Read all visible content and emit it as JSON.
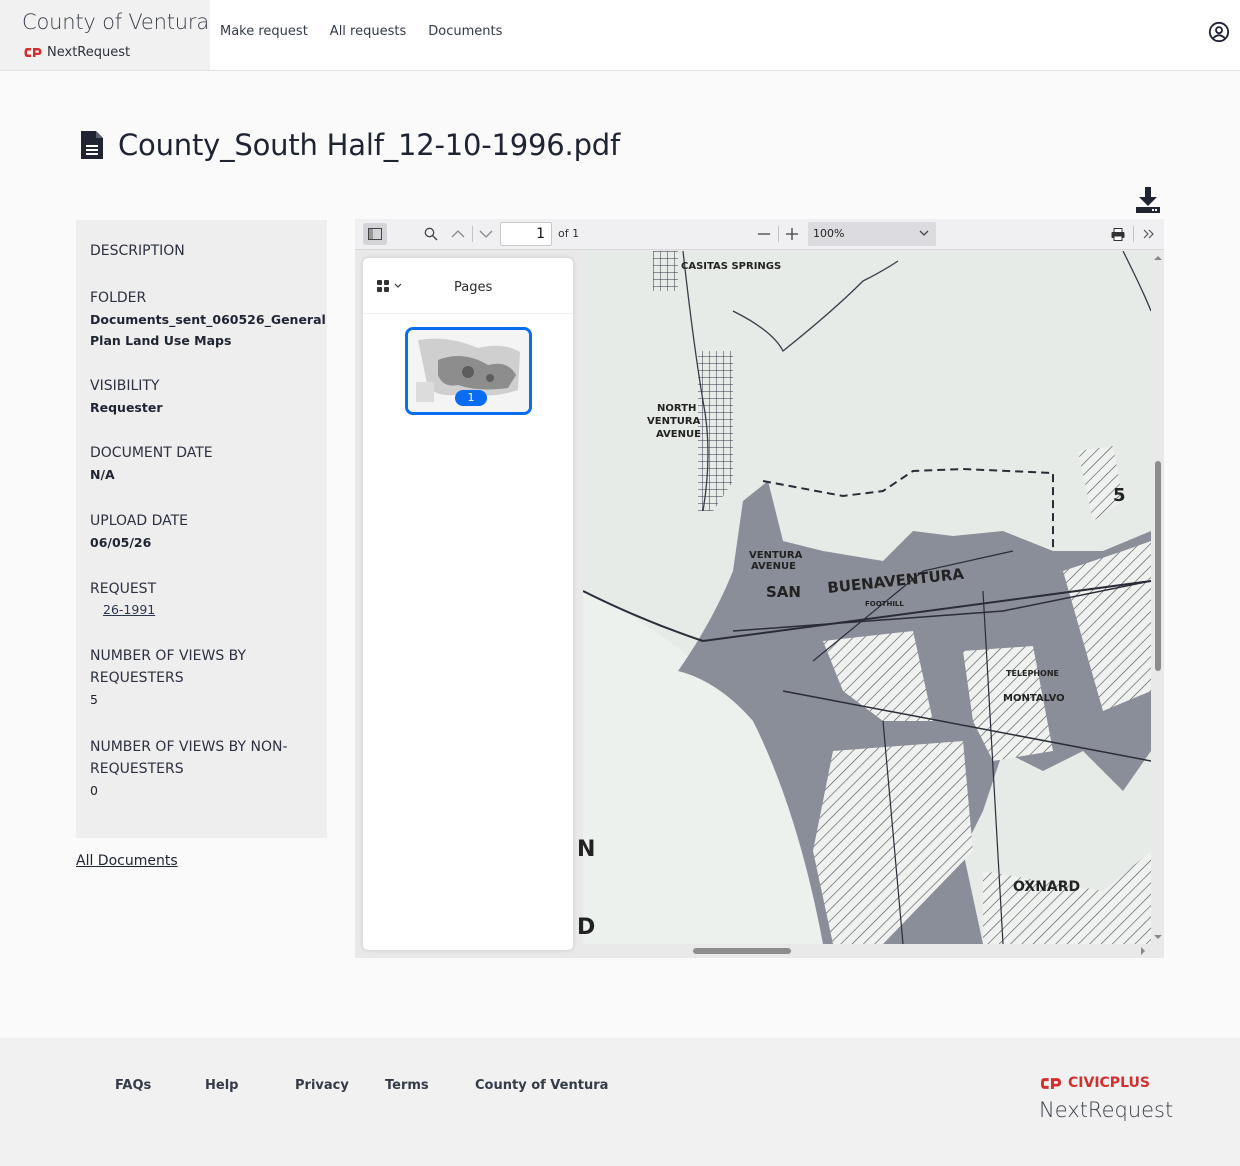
{
  "header": {
    "org_name": "County of Ventura",
    "product_name": "NextRequest",
    "nav": [
      "Make request",
      "All requests",
      "Documents"
    ],
    "account_icon": "user-circle-icon"
  },
  "document": {
    "title": "County_South Half_12-10-1996.pdf",
    "icon": "file-text-icon",
    "download_icon": "download-icon"
  },
  "details": {
    "description_label": "DESCRIPTION",
    "folder_label": "FOLDER",
    "folder_line1": "Documents_sent_060526_General",
    "folder_line2": "Plan Land Use Maps",
    "visibility_label": "VISIBILITY",
    "visibility_value": "Requester",
    "document_date_label": "DOCUMENT DATE",
    "document_date_value": "N/A",
    "upload_date_label": "UPLOAD DATE",
    "upload_date_value": "06/05/26",
    "request_label": "REQUEST",
    "request_value": "26-1991",
    "views_req_label_1": "NUMBER OF VIEWS BY",
    "views_req_label_2": "REQUESTERS",
    "views_req_value": "5",
    "views_nonreq_label_1": "NUMBER OF VIEWS BY NON-",
    "views_nonreq_label_2": "REQUESTERS",
    "views_nonreq_value": "0"
  },
  "all_documents_link": "All Documents",
  "viewer": {
    "page_number": "1",
    "page_of": "of 1",
    "zoom": "100%",
    "pages_label": "Pages",
    "thumbnail_page": "1",
    "map_labels": {
      "casitas": "CASITAS SPRINGS",
      "north_ventura_1": "NORTH",
      "north_ventura_2": "VENTURA",
      "north_ventura_3": "AVENUE",
      "ventura_ave_1": "VENTURA",
      "ventura_ave_2": "AVENUE",
      "san": "SAN",
      "buenaventura": "BUENAVENTURA",
      "oxnard": "OXNARD",
      "montalvo": "MONTALVO",
      "foothill": "FOOTHILL",
      "telephone": "TELEPHONE",
      "five": "5",
      "edge_n": "N",
      "edge_d": "D"
    }
  },
  "footer": {
    "links": [
      "FAQs",
      "Help",
      "Privacy",
      "Terms",
      "County of Ventura"
    ],
    "civic_plus": "CIVICPLUS",
    "next_request": "NextRequest"
  },
  "colors": {
    "accent_blue": "#0a6cf0",
    "brand_red": "#d32f2f"
  }
}
